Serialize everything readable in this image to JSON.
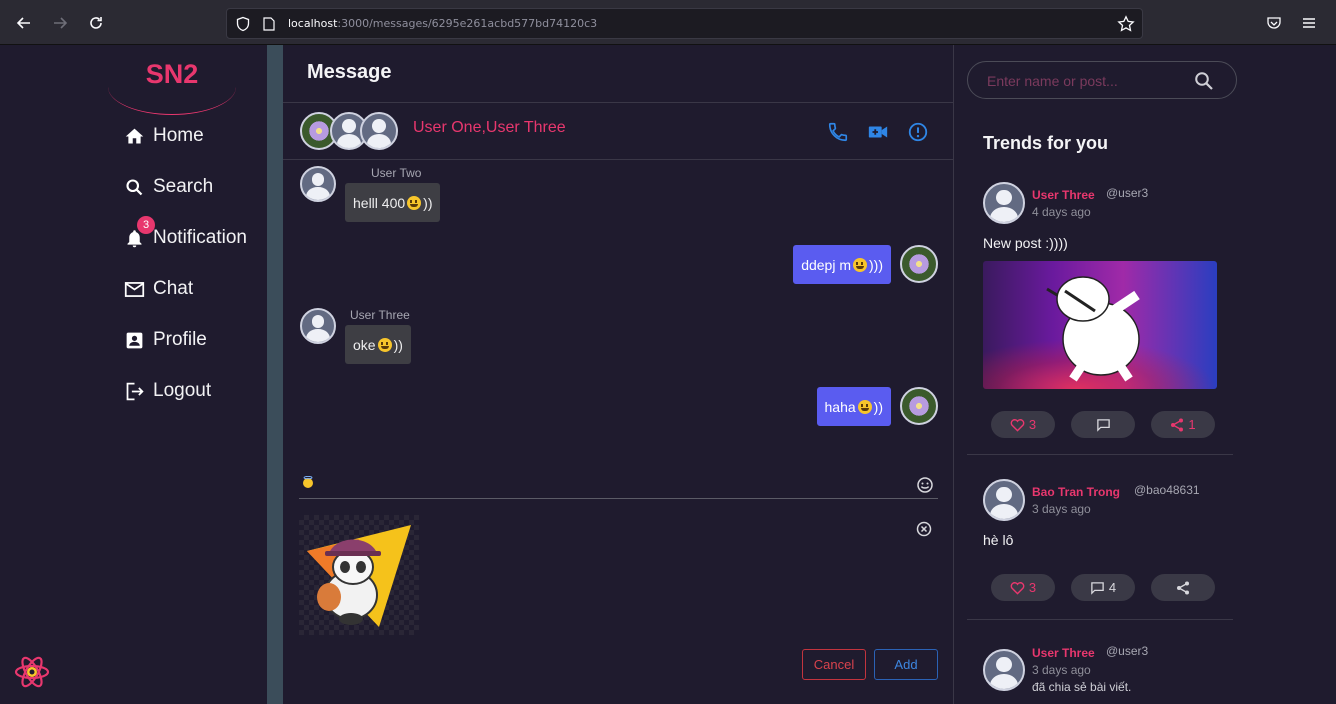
{
  "browser": {
    "url_host": "localhost",
    "url_rest": ":3000/messages/6295e261acbd577bd74120c3"
  },
  "sidebar": {
    "logo": "SN2",
    "items": [
      {
        "label": "Home",
        "icon": "home-icon"
      },
      {
        "label": "Search",
        "icon": "search-icon"
      },
      {
        "label": "Notification",
        "icon": "bell-icon",
        "badge": "3"
      },
      {
        "label": "Chat",
        "icon": "mail-icon"
      },
      {
        "label": "Profile",
        "icon": "profile-icon"
      },
      {
        "label": "Logout",
        "icon": "logout-icon"
      }
    ]
  },
  "chat": {
    "title": "Message",
    "conversation": "User One,User Three",
    "messages": [
      {
        "sender": "User Two",
        "text": "helll 400 ",
        "suffix": "))",
        "direction": "in"
      },
      {
        "sender": "",
        "text": "ddepj m ",
        "suffix": ")))",
        "direction": "out"
      },
      {
        "sender": "User Three",
        "text": "oke ",
        "suffix": "))",
        "direction": "in"
      },
      {
        "sender": "",
        "text": "haha ",
        "suffix": "))",
        "direction": "out"
      }
    ],
    "cancel_label": "Cancel",
    "add_label": "Add"
  },
  "right": {
    "search_placeholder": "Enter name or post...",
    "trends_title": "Trends for you",
    "posts": [
      {
        "author": "User Three",
        "handle": "@user3",
        "time": "4 days ago",
        "text": "New post :))))",
        "likes": "3",
        "comments": "",
        "shares": "1"
      },
      {
        "author": "Bao Tran Trong",
        "handle": "@bao48631",
        "time": "3 days ago",
        "text": "hè lô",
        "likes": "3",
        "comments": "4",
        "shares": ""
      },
      {
        "author": "User Three",
        "handle": "@user3",
        "time": "3 days ago",
        "text": "đã chia sẻ bài viết."
      }
    ]
  },
  "colors": {
    "accent": "#e8376e",
    "outgoing_bubble": "#5a5cf0",
    "incoming_bubble": "#3e3e44",
    "icon_blue": "#2f86e6"
  }
}
